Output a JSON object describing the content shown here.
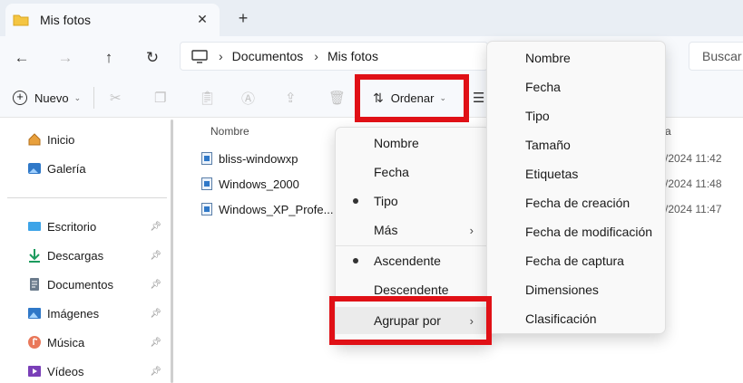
{
  "tab": {
    "title": "Mis fotos",
    "close": "✕",
    "new_tab": "+"
  },
  "nav": {
    "back": "←",
    "forward": "→",
    "up": "↑",
    "refresh": "↻"
  },
  "address": {
    "crumbs": [
      "Documentos",
      "Mis fotos"
    ],
    "separator": "›"
  },
  "search": {
    "placeholder": "Buscar"
  },
  "toolbar": {
    "new_label": "Nuevo",
    "sort_label": "Ordenar"
  },
  "sidebar": {
    "items": [
      {
        "label": "Inicio",
        "icon": "home-icon"
      },
      {
        "label": "Galería",
        "icon": "gallery-icon"
      },
      {
        "label": "Escritorio",
        "icon": "desktop-icon"
      },
      {
        "label": "Descargas",
        "icon": "downloads-icon"
      },
      {
        "label": "Documentos",
        "icon": "documents-icon"
      },
      {
        "label": "Imágenes",
        "icon": "pictures-icon"
      },
      {
        "label": "Música",
        "icon": "music-icon"
      },
      {
        "label": "Vídeos",
        "icon": "videos-icon"
      }
    ]
  },
  "filelist": {
    "column_name": "Nombre",
    "column_date_partial": "a",
    "files": [
      {
        "name": "bliss-windowxp",
        "date": "/2024 11:42"
      },
      {
        "name": "Windows_2000",
        "date": "/2024 11:48"
      },
      {
        "name": "Windows_XP_Profe...",
        "date": "/2024 11:47"
      }
    ]
  },
  "sort_menu": {
    "items": [
      "Nombre",
      "Fecha",
      "Tipo",
      "Más",
      "Ascendente",
      "Descendente",
      "Agrupar por"
    ]
  },
  "group_menu": {
    "items": [
      "Nombre",
      "Fecha",
      "Tipo",
      "Tamaño",
      "Etiquetas",
      "Fecha de creación",
      "Fecha de modificación",
      "Fecha de captura",
      "Dimensiones",
      "Clasificación"
    ]
  },
  "colors": {
    "highlight": "#e01016",
    "accent": "#2f78c8",
    "folder": "#f4c542"
  }
}
